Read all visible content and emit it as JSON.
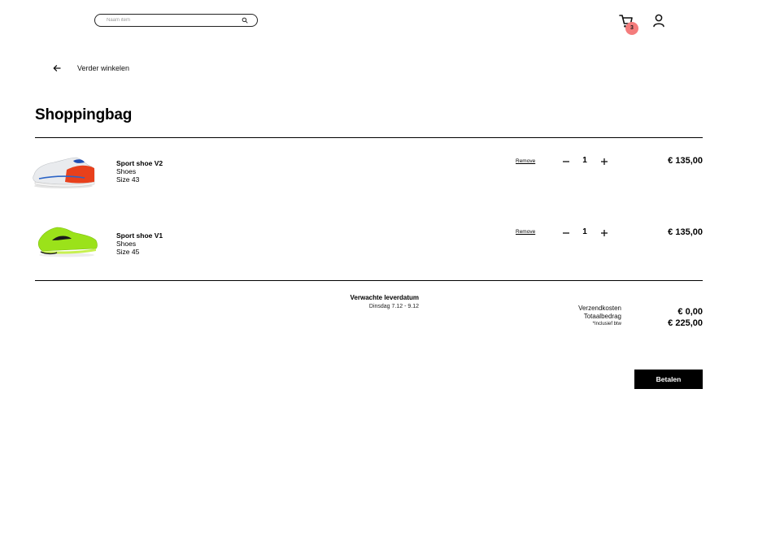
{
  "header": {
    "search": {
      "placeholder": "Naam item",
      "value": ""
    },
    "cart_count": "3"
  },
  "nav": {
    "back_label": "Verder winkelen"
  },
  "page_title": "Shoppingbag",
  "items": [
    {
      "name": "Sport shoe V2",
      "category": "Shoes",
      "size": "Size 43",
      "remove_label": "Remove",
      "quantity": "1",
      "price": "€ 135,00",
      "color": "white/red/blue"
    },
    {
      "name": "Sport shoe V1",
      "category": "Shoes",
      "size": "Size 45",
      "remove_label": "Remove",
      "quantity": "1",
      "price": "€ 135,00",
      "color": "neon green/black"
    }
  ],
  "delivery": {
    "title": "Verwachte leverdatum",
    "date": "Dinsdag 7.12 - 9.12"
  },
  "summary": {
    "shipping_label": "Verzendkosten",
    "shipping_value": "€ 0,00",
    "total_label": "Totaalbedrag",
    "total_value": "€ 225,00",
    "vat_note": "*Inclusief btw"
  },
  "pay_button": "Betalen",
  "colors": {
    "badge": "#f47c7c",
    "button": "#000000",
    "accent_red": "#e8401c",
    "accent_green": "#9be21a"
  }
}
